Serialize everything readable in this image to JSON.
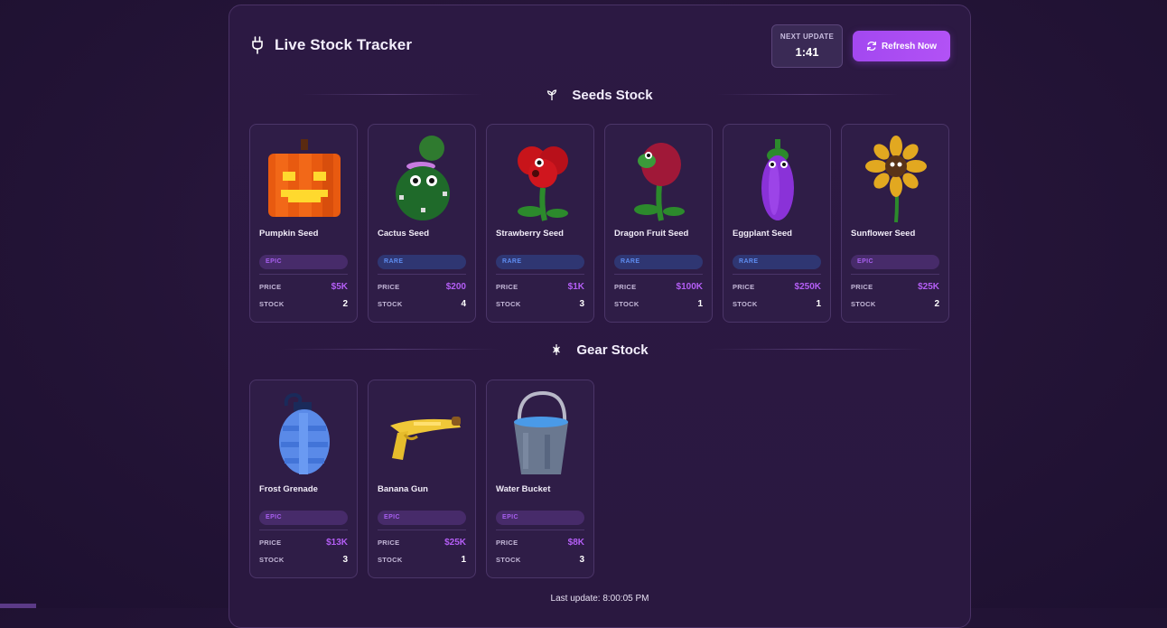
{
  "header": {
    "title": "Live Stock Tracker",
    "next_update_label": "NEXT UPDATE",
    "next_update_time": "1:41",
    "refresh_label": "Refresh Now",
    "icon": "plug-icon"
  },
  "sections": {
    "seeds": {
      "title": "Seeds Stock",
      "icon": "sprout-icon"
    },
    "gear": {
      "title": "Gear Stock",
      "icon": "gear-icon"
    }
  },
  "labels": {
    "price": "PRICE",
    "stock": "STOCK"
  },
  "seeds": [
    {
      "name": "Pumpkin Seed",
      "rarity": "EPIC",
      "price": "$5K",
      "stock": "2",
      "icon": "pumpkin-icon"
    },
    {
      "name": "Cactus Seed",
      "rarity": "RARE",
      "price": "$200",
      "stock": "4",
      "icon": "cactus-icon"
    },
    {
      "name": "Strawberry Seed",
      "rarity": "RARE",
      "price": "$1K",
      "stock": "3",
      "icon": "strawberry-icon"
    },
    {
      "name": "Dragon Fruit Seed",
      "rarity": "RARE",
      "price": "$100K",
      "stock": "1",
      "icon": "dragon-fruit-icon"
    },
    {
      "name": "Eggplant Seed",
      "rarity": "RARE",
      "price": "$250K",
      "stock": "1",
      "icon": "eggplant-icon"
    },
    {
      "name": "Sunflower Seed",
      "rarity": "EPIC",
      "price": "$25K",
      "stock": "2",
      "icon": "sunflower-icon"
    }
  ],
  "gear": [
    {
      "name": "Frost Grenade",
      "rarity": "EPIC",
      "price": "$13K",
      "stock": "3",
      "icon": "frost-grenade-icon"
    },
    {
      "name": "Banana Gun",
      "rarity": "EPIC",
      "price": "$25K",
      "stock": "1",
      "icon": "banana-gun-icon"
    },
    {
      "name": "Water Bucket",
      "rarity": "EPIC",
      "price": "$8K",
      "stock": "3",
      "icon": "water-bucket-icon"
    }
  ],
  "footer": {
    "last_update": "Last update: 8:00:05 PM"
  },
  "colors": {
    "accent": "#b252f5",
    "epic": "#a85ff0",
    "rare": "#5e8cf0",
    "price": "#b45ef5"
  }
}
